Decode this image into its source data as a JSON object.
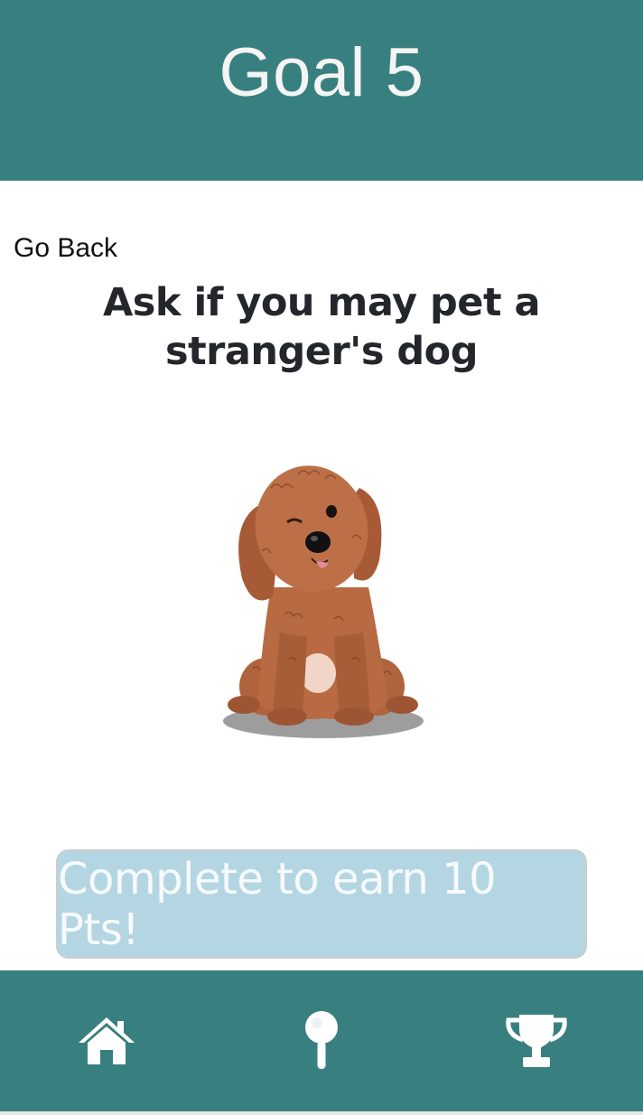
{
  "header": {
    "title": "Goal 5"
  },
  "navigation": {
    "back_label": "Go Back"
  },
  "goal": {
    "text": "Ask if you may pet a stranger's dog"
  },
  "action": {
    "complete_label": "Complete to earn 10 Pts!"
  },
  "footer": {
    "items": [
      {
        "icon": "home-icon"
      },
      {
        "icon": "search-icon"
      },
      {
        "icon": "trophy-icon"
      }
    ]
  },
  "colors": {
    "header_bg": "#38807f",
    "footer_bg": "#38807f",
    "button_bg": "#b4d6e2",
    "button_text": "#f7fafc",
    "title_text": "#f4f4f4"
  }
}
